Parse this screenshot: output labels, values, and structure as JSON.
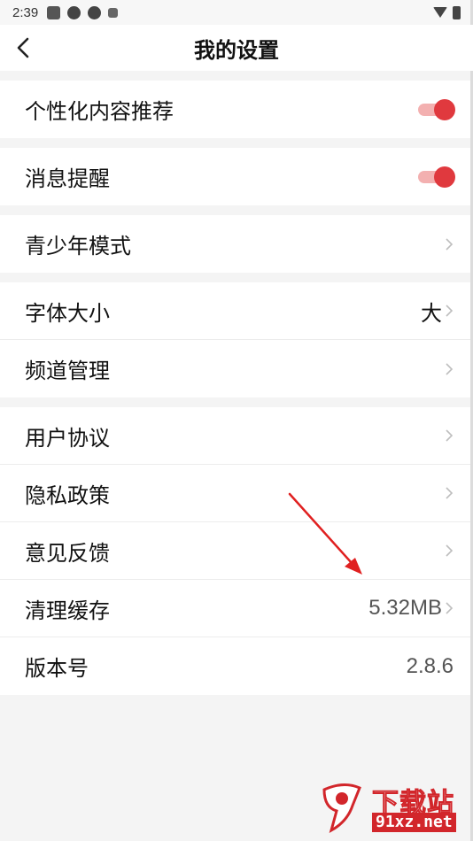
{
  "status_bar": {
    "time": "2:39"
  },
  "header": {
    "title": "我的设置"
  },
  "groups": [
    {
      "items": [
        {
          "label": "个性化内容推荐",
          "control": "toggle",
          "on": true
        }
      ]
    },
    {
      "items": [
        {
          "label": "消息提醒",
          "control": "toggle",
          "on": true
        }
      ]
    },
    {
      "items": [
        {
          "label": "青少年模式",
          "control": "chevron"
        }
      ]
    },
    {
      "items": [
        {
          "label": "字体大小",
          "value": "大",
          "control": "chevron"
        },
        {
          "label": "频道管理",
          "control": "chevron"
        }
      ]
    },
    {
      "items": [
        {
          "label": "用户协议",
          "control": "chevron"
        },
        {
          "label": "隐私政策",
          "control": "chevron"
        },
        {
          "label": "意见反馈",
          "control": "chevron"
        },
        {
          "label": "清理缓存",
          "value": "5.32MB",
          "control": "chevron"
        },
        {
          "label": "版本号",
          "value": "2.8.6"
        }
      ]
    }
  ],
  "watermark": {
    "text": "下载站",
    "url": "91xz.net"
  },
  "colors": {
    "accent": "#e0393e",
    "toggle_track": "#f3b0b0",
    "annotation_arrow": "#e02020",
    "background": "#f4f4f4"
  },
  "icons": {
    "back": "arrow-left-icon",
    "chevron": "chevron-right-icon"
  }
}
